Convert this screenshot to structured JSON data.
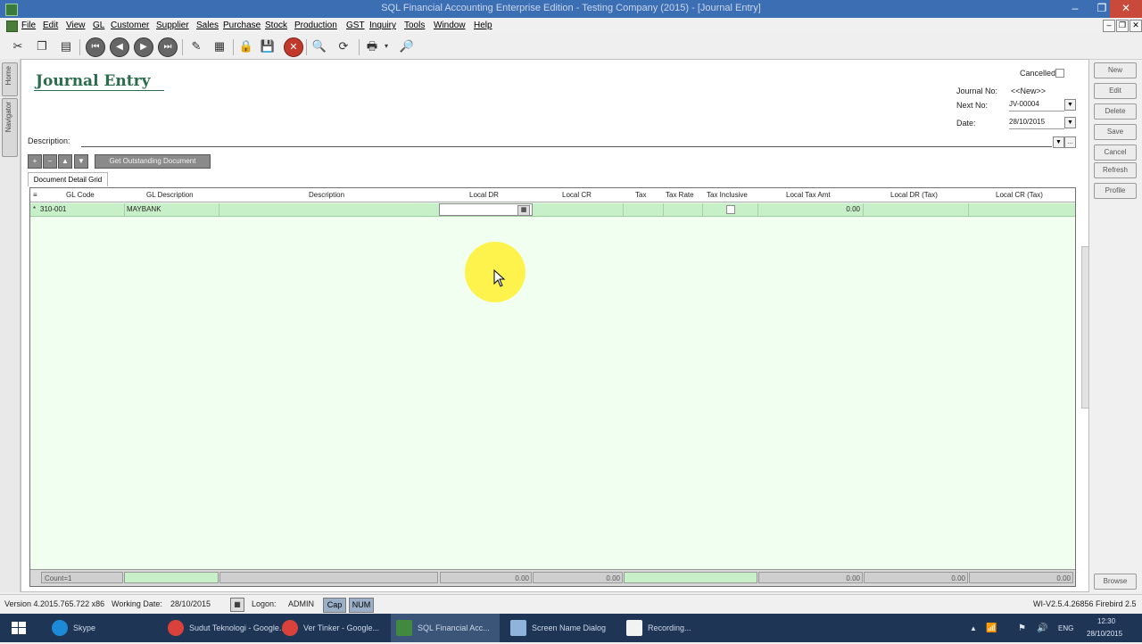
{
  "window": {
    "title": "SQL Financial Accounting Enterprise Edition - Testing Company (2015) - [Journal Entry]",
    "controls": [
      "‒",
      "❐",
      "✕"
    ]
  },
  "menu": [
    "File",
    "Edit",
    "View",
    "GL",
    "Customer",
    "Supplier",
    "Sales",
    "Purchase",
    "Stock",
    "Production",
    "GST",
    "Inquiry",
    "Tools",
    "Window",
    "Help"
  ],
  "side_tabs": [
    "Home",
    "Navigator"
  ],
  "form": {
    "title": "Journal Entry",
    "cancelled_label": "Cancelled",
    "journal_no_label": "Journal No:",
    "journal_no_value": "<<New>>",
    "next_no_label": "Next No:",
    "next_no_value": "JV-00004",
    "date_label": "Date:",
    "date_value": "28/10/2015",
    "description_label": "Description:",
    "description_value": "",
    "get_from_label": "Get Outstanding Document",
    "tab_label": "Document Detail Grid"
  },
  "right_buttons": [
    "New",
    "Edit",
    "Delete",
    "Save",
    "Cancel",
    "Refresh",
    "Profile"
  ],
  "browse_button": "Browse",
  "grid": {
    "columns": [
      "GL Code",
      "GL Description",
      "Description",
      "Local DR",
      "Local CR",
      "Tax",
      "Tax Rate",
      "Tax Inclusive",
      "Local Tax Amt",
      "Local DR (Tax)",
      "Local CR (Tax)"
    ],
    "rows": [
      {
        "marker": "*",
        "gl_code": "310-001",
        "gl_description": "MAYBANK",
        "description": "",
        "local_dr": "",
        "local_cr": "",
        "tax": "",
        "tax_rate": "",
        "tax_inclusive": false,
        "local_tax_amt": "0.00",
        "local_dr_tax": "",
        "local_cr_tax": ""
      }
    ],
    "footer": {
      "count": "Count=1",
      "local_dr_total": "0.00",
      "local_cr_total": "0.00",
      "local_tax_amt_total": "0.00",
      "local_dr_tax_total": "0.00",
      "local_cr_tax_total": "0.00"
    }
  },
  "status": {
    "version": "Version 4.2015.765.722 x86",
    "working_date_label": "Working Date:",
    "working_date": "28/10/2015",
    "logon_label": "Logon:",
    "logon_user": "ADMIN",
    "cap": "Cap",
    "num": "NUM",
    "db_version": "WI-V2.5.4.26856 Firebird 2.5"
  },
  "taskbar": {
    "items": [
      "Skype",
      "Sudut Teknologi - Google...",
      "Ver Tinker - Google...",
      "SQL Financial Acc...",
      "Screen Name Dialog",
      "Recording..."
    ],
    "language": "ENG",
    "time": "12:30",
    "date": "28/10/2015"
  },
  "colors": {
    "title_bar": "#3c6eb4",
    "form_title": "#2b6c4d",
    "grid_row": "#c8f0c8",
    "taskbar": "#1f3556",
    "cursor_highlight": "#fff23a"
  }
}
